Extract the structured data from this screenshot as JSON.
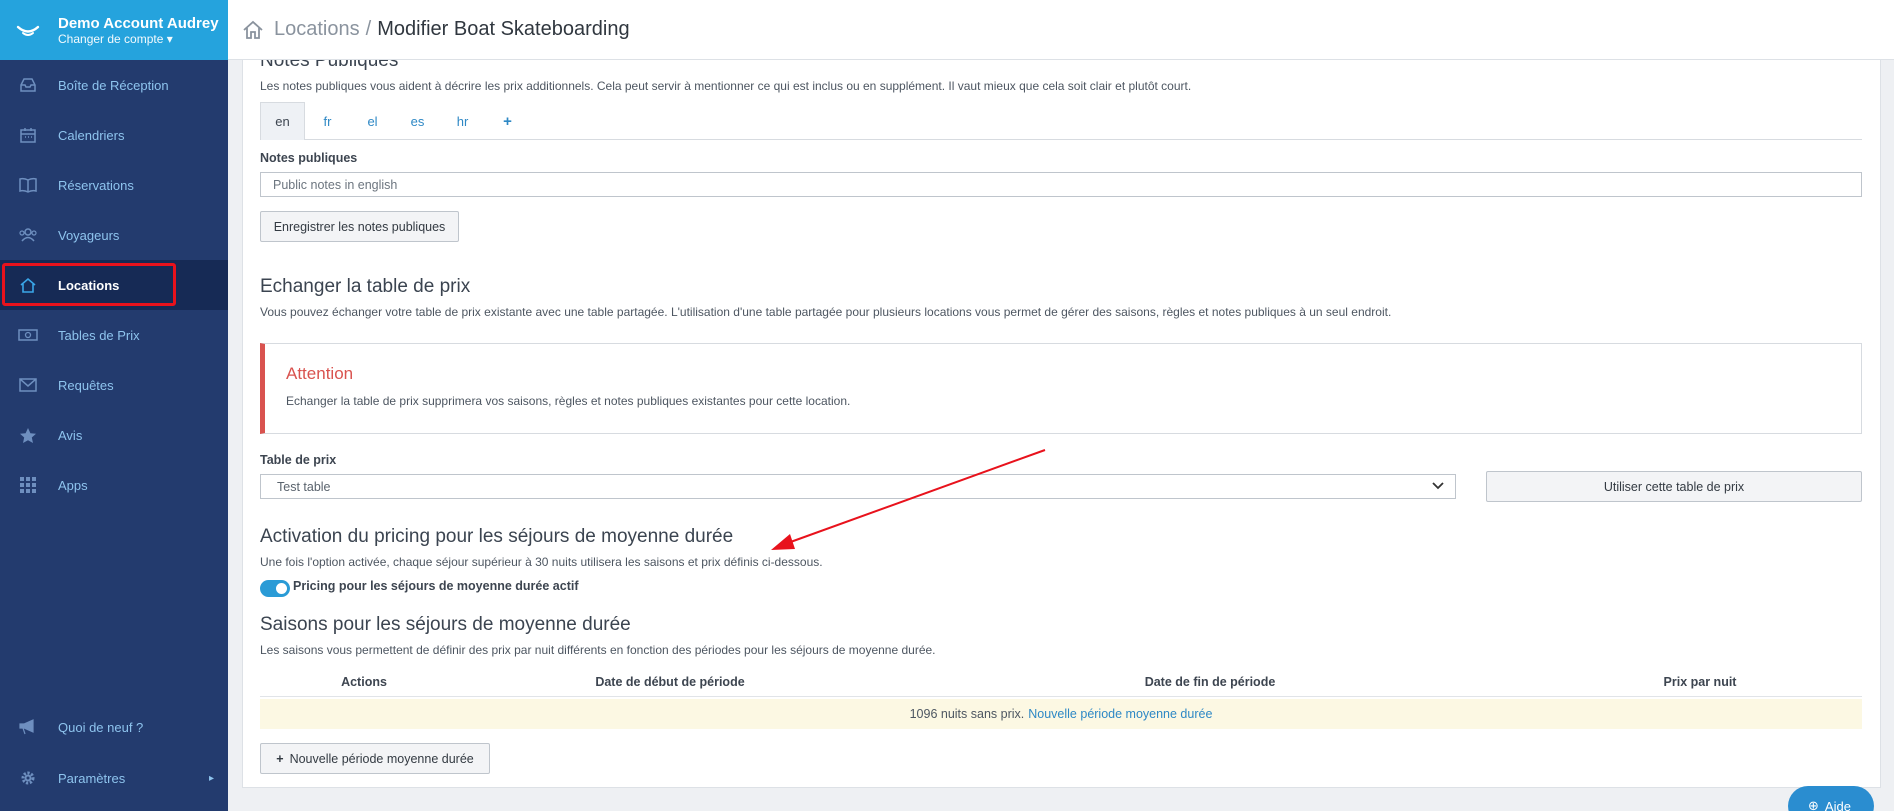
{
  "account": {
    "name": "Demo Account Audrey",
    "switch_label": "Changer de compte"
  },
  "sidebar": {
    "items": [
      {
        "label": "Boîte de Réception",
        "icon": "inbox-icon"
      },
      {
        "label": "Calendriers",
        "icon": "calendar-icon"
      },
      {
        "label": "Réservations",
        "icon": "book-icon"
      },
      {
        "label": "Voyageurs",
        "icon": "users-icon"
      },
      {
        "label": "Locations",
        "icon": "home-icon",
        "active": true
      },
      {
        "label": "Tables de Prix",
        "icon": "money-icon"
      },
      {
        "label": "Requêtes",
        "icon": "envelope-icon"
      },
      {
        "label": "Avis",
        "icon": "star-icon"
      },
      {
        "label": "Apps",
        "icon": "grid-icon"
      }
    ],
    "bottom": [
      {
        "label": "Quoi de neuf ?",
        "icon": "megaphone-icon"
      },
      {
        "label": "Paramètres",
        "icon": "gear-icon"
      }
    ]
  },
  "breadcrumb": {
    "parent": "Locations",
    "separator": "/",
    "current": "Modifier Boat Skateboarding"
  },
  "public_notes": {
    "heading": "Notes Publiques",
    "help": "Les notes publiques vous aident à décrire les prix additionnels. Cela peut servir à mentionner ce qui est inclus ou en supplément. Il vaut mieux que cela soit clair et plutôt court.",
    "tabs": [
      "en",
      "fr",
      "el",
      "es",
      "hr"
    ],
    "add_tab": "+",
    "field_label": "Notes publiques",
    "placeholder": "Public notes in english",
    "save_button": "Enregistrer les notes publiques"
  },
  "exchange": {
    "heading": "Echanger la table de prix",
    "help": "Vous pouvez échanger votre table de prix existante avec une table partagée. L'utilisation d'une table partagée pour plusieurs locations vous permet de gérer des saisons, règles et notes publiques à un seul endroit.",
    "alert_title": "Attention",
    "alert_text": "Echanger la table de prix supprimera vos saisons, règles et notes publiques existantes pour cette location.",
    "select_label": "Table de prix",
    "select_value": "Test table",
    "use_button": "Utiliser cette table de prix"
  },
  "medium_stay": {
    "heading": "Activation du pricing pour les séjours de moyenne durée",
    "help": "Une fois l'option activée, chaque séjour supérieur à 30 nuits utilisera les saisons et prix définis ci-dessous.",
    "toggle_label": "Pricing pour les séjours de moyenne durée actif",
    "toggle_on": true
  },
  "seasons": {
    "heading": "Saisons pour les séjours de moyenne durée",
    "help": "Les saisons vous permettent de définir des prix par nuit différents en fonction des périodes pour les séjours de moyenne durée.",
    "columns": [
      "Actions",
      "Date de début de période",
      "Date de fin de période",
      "Prix par nuit"
    ],
    "empty_text": "1096 nuits sans prix.",
    "empty_link": "Nouvelle période moyenne durée",
    "new_button": "Nouvelle période moyenne durée"
  },
  "help_button": "Aide",
  "colors": {
    "sidebar": "#233b6e",
    "account": "#25a3dd",
    "accent": "#2e88c5",
    "alert": "#d9534f",
    "annotation": "#e8121c"
  }
}
